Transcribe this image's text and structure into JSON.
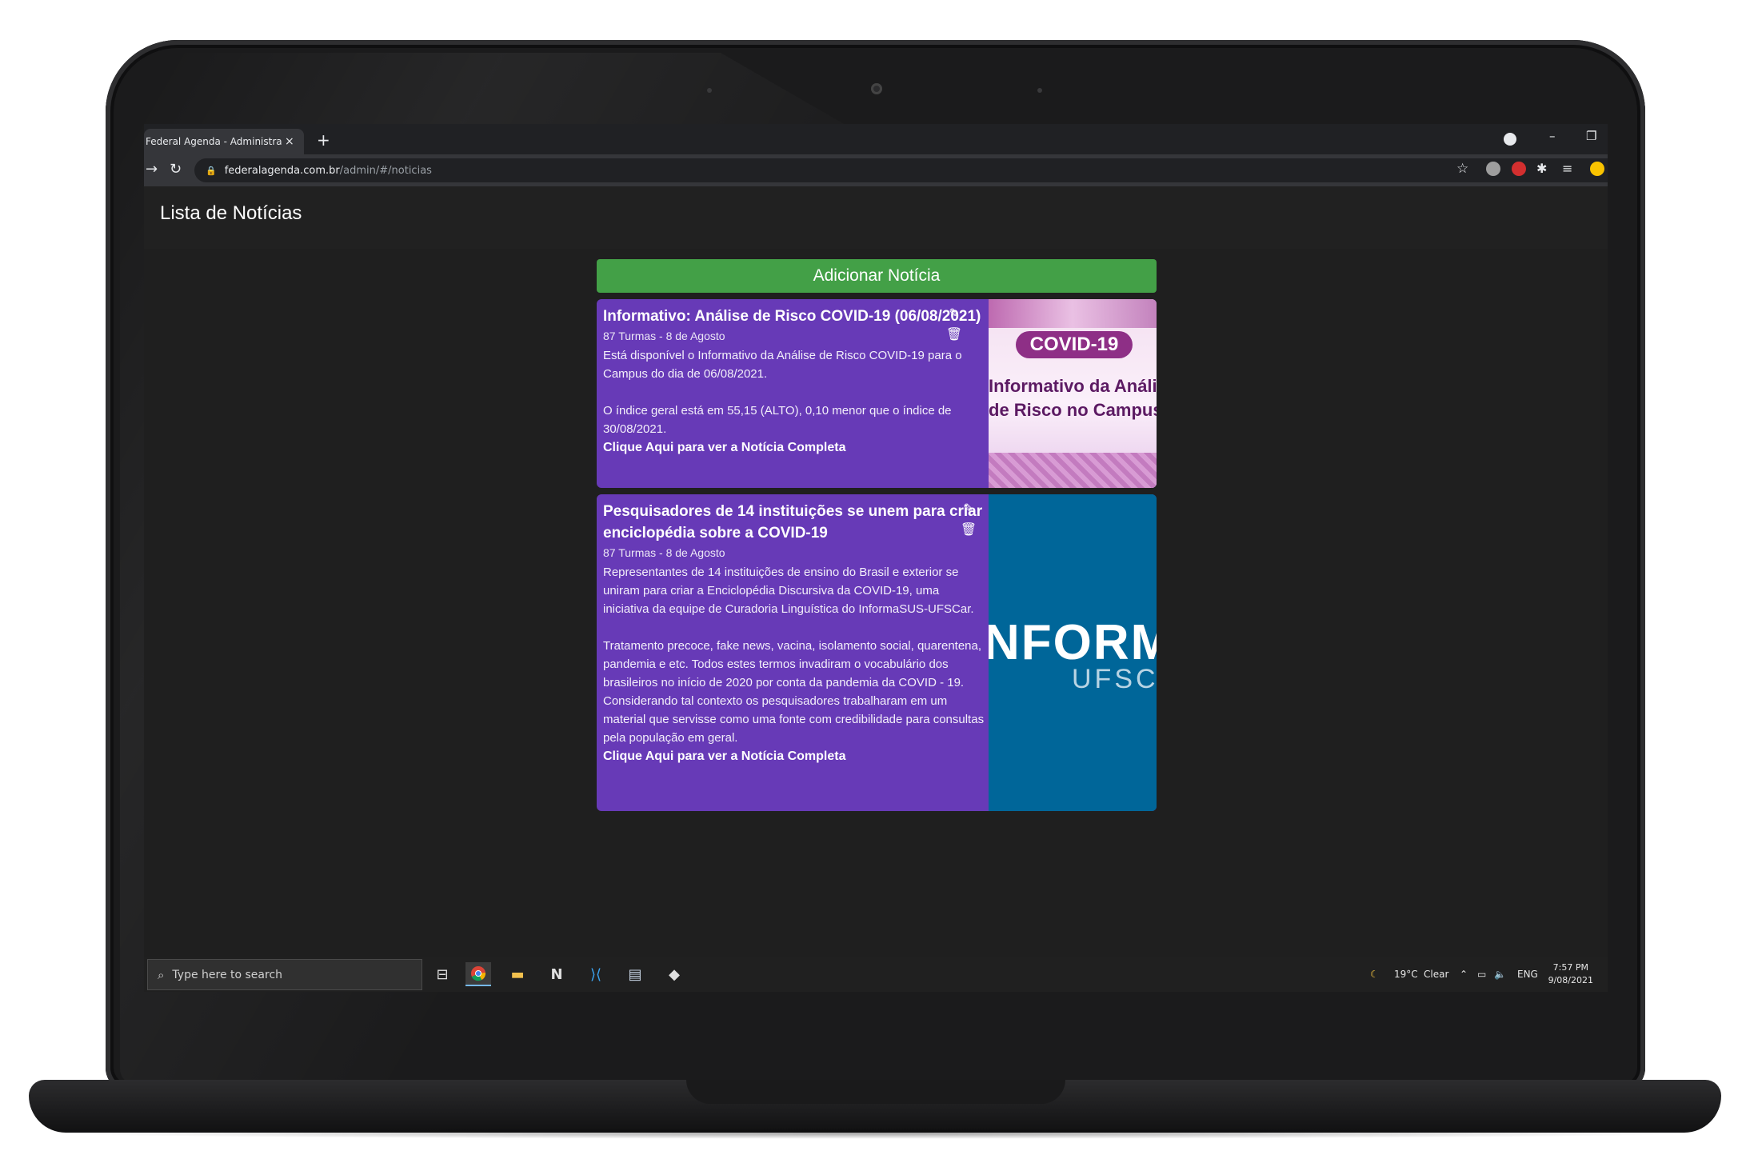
{
  "browser": {
    "tab_title": "Federal Agenda - Administração",
    "tab_close": "×",
    "new_tab": "+",
    "url_host": "federalagenda.com.br",
    "url_path": "/admin/#/noticias",
    "minimize": "–",
    "restore": "❐"
  },
  "page": {
    "title": "Lista de Notícias",
    "add_button_label": "Adicionar Notícia"
  },
  "news": [
    {
      "title": "Informativo: Análise de Risco COVID-19 (06/08/2021)",
      "meta": "87 Turmas - 8 de Agosto",
      "body": "Está disponível o Informativo da Análise de Risco COVID-19 para o Campus do dia de 06/08/2021.\n\nO índice geral está em 55,15 (ALTO), 0,10 menor que o índice de 30/08/2021.",
      "link_label": "Clique Aqui para ver a Notícia Completa",
      "image_text": {
        "pill": "COVID-19",
        "line1": "Informativo da Análise",
        "line2": "de Risco no Campus"
      }
    },
    {
      "title": "Pesquisadores de 14 instituições se unem para criar enciclopédia sobre a COVID-19",
      "meta": "87 Turmas - 8 de Agosto",
      "body": "Representantes de 14 instituições de ensino do Brasil e exterior se uniram para criar a Enciclopédia Discursiva da COVID-19, uma iniciativa da equipe de Curadoria Linguística do InformaSUS-UFSCar.\n\nTratamento precoce, fake news, vacina, isolamento social, quarentena, pandemia e etc. Todos estes termos invadiram o vocabulário dos brasileiros no início de 2020 por conta da pandemia da COVID - 19. Considerando tal contexto os pesquisadores trabalharam em um material que servisse como uma fonte com credibilidade para consultas pela população em geral.",
      "link_label": "Clique Aqui para ver a Notícia Completa",
      "image_text": {
        "big": "NFORM",
        "small": "UFSC"
      }
    }
  ],
  "taskbar": {
    "search_placeholder": "Type here to search",
    "weather_temp": "19°C",
    "weather_desc": "Clear",
    "language": "ENG",
    "time": "7:57 PM",
    "date": "9/08/2021"
  },
  "colors": {
    "add_button": "#43a047",
    "card": "#673ab7",
    "ufsc_blue": "#006699"
  }
}
